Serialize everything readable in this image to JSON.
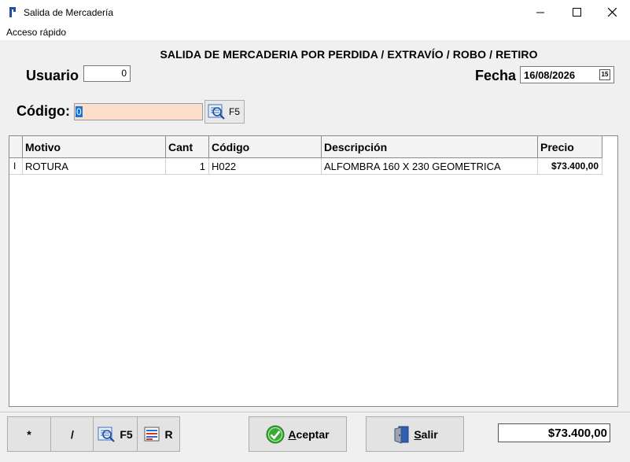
{
  "window": {
    "title": "Salida de Mercadería",
    "minimize_icon": "minimize-icon",
    "maximize_icon": "maximize-icon",
    "close_icon": "close-icon"
  },
  "menu": {
    "items": [
      "Acceso rápido"
    ]
  },
  "form": {
    "heading": "SALIDA DE MERCADERIA POR PERDIDA / EXTRAVÍO / ROBO / RETIRO",
    "usuario_label": "Usuario",
    "usuario_value": "0",
    "fecha_label": "Fecha",
    "fecha_value": "16/08/2026",
    "codigo_label": "Código:",
    "codigo_value": "0",
    "codigo_field_color": "#fbdfcb",
    "search_button_label": "F5"
  },
  "grid": {
    "columns": [
      "Motivo",
      "Cant",
      "Código",
      "Descripción",
      "Precio"
    ],
    "row_indicator": "I",
    "rows": [
      {
        "motivo": "ROTURA",
        "cant": "1",
        "codigo": "H022",
        "descripcion": "ALFOMBRA 160 X 230 GEOMETRICA",
        "precio": "$73.400,00"
      }
    ]
  },
  "toolbar": {
    "star_label": "*",
    "slash_label": "/",
    "f5_label": "F5",
    "r_label": "R",
    "aceptar_first": "A",
    "aceptar_rest": "ceptar",
    "salir_first": "S",
    "salir_rest": "alir",
    "accept_icon_color": "#3aaa35"
  },
  "total": "$73.400,00"
}
